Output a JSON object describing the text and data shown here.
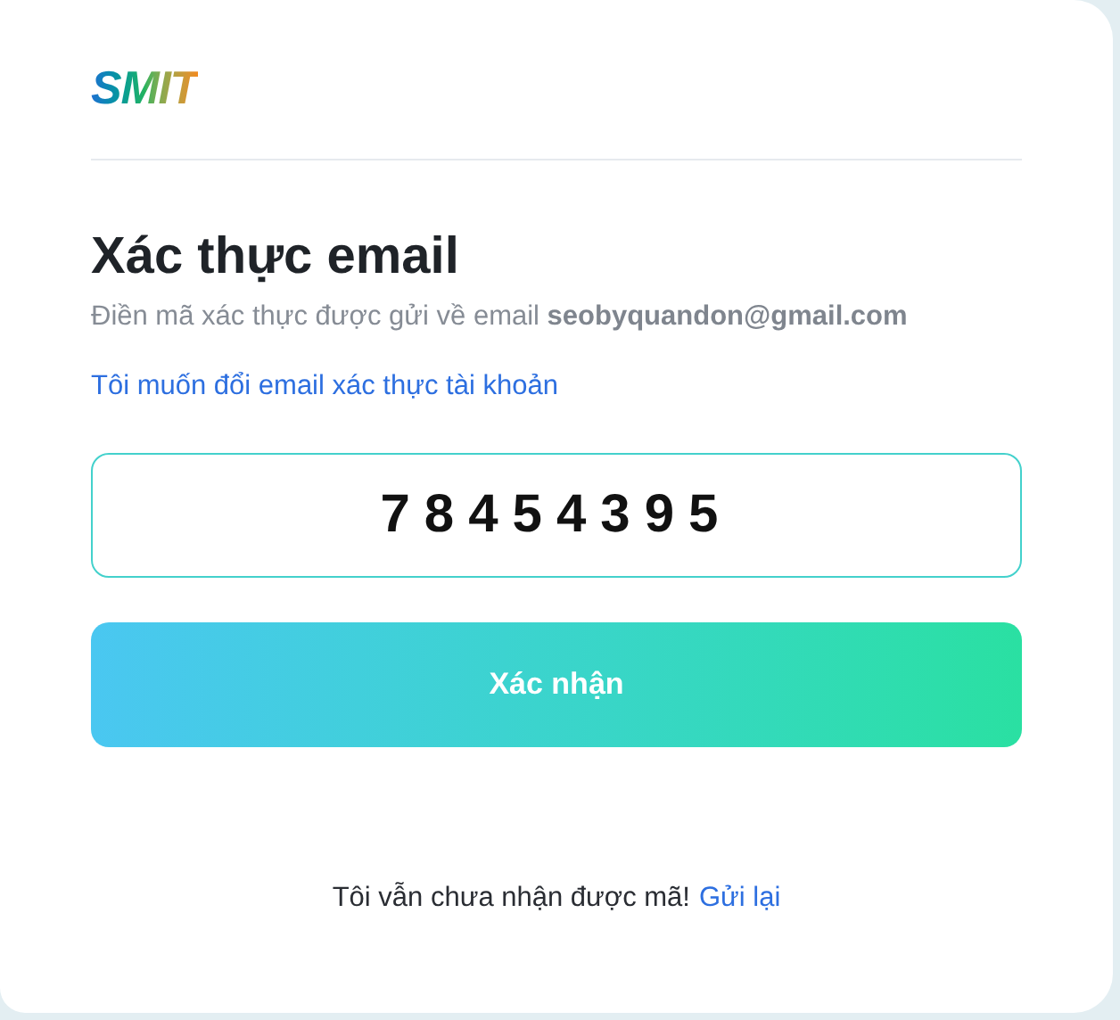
{
  "logo": "SMIT",
  "title": "Xác thực email",
  "description": "Điền mã xác thực được gửi về email **seobyquandon@gmail.com**",
  "change_email_link": "Tôi muốn đổi email xác thực tài khoản",
  "code_field": {
    "value": "78454395"
  },
  "submit_button": "Xác nhận",
  "resend": {
    "text": "Tôi vẫn chưa nhận được mã!",
    "link": "Gửi lại"
  }
}
